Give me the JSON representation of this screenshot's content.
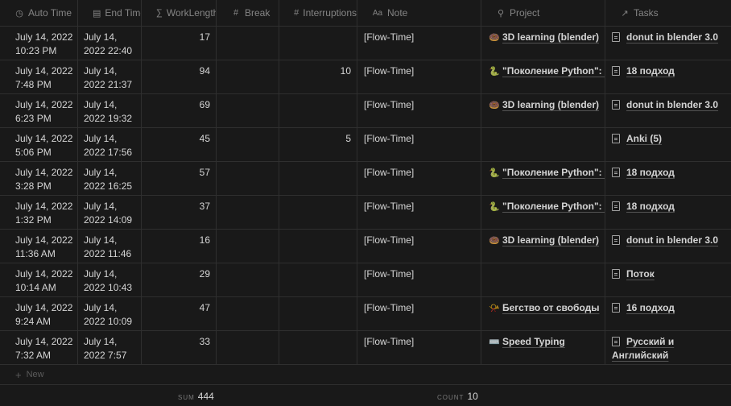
{
  "columns": [
    {
      "label": "Auto Time",
      "icon": "clock-icon",
      "glyph": "◷"
    },
    {
      "label": "End Time",
      "icon": "calendar-icon",
      "glyph": "▤"
    },
    {
      "label": "WorkLength",
      "icon": "sigma-icon",
      "glyph": "∑"
    },
    {
      "label": "Break",
      "icon": "hash-icon",
      "glyph": "#"
    },
    {
      "label": "Interruptions",
      "icon": "hash-icon",
      "glyph": "#"
    },
    {
      "label": "Note",
      "icon": "text-icon",
      "glyph": "Aa"
    },
    {
      "label": "Project",
      "icon": "search-icon",
      "glyph": "⚲"
    },
    {
      "label": "Tasks",
      "icon": "arrow-up-right-icon",
      "glyph": "↗"
    }
  ],
  "rows": [
    {
      "auto_date": "July 14, 2022",
      "auto_time": "10:23 PM",
      "end_date": "July 14,",
      "end_time": "2022 22:40",
      "work": "17",
      "break": "",
      "interruptions": "",
      "note": "[Flow-Time]",
      "project_emoji": "🍩",
      "project": "3D learning (blender)",
      "task": "donut in blender 3.0"
    },
    {
      "auto_date": "July 14, 2022",
      "auto_time": "7:48 PM",
      "end_date": "July 14,",
      "end_time": "2022 21:37",
      "work": "94",
      "break": "",
      "interruptions": "10",
      "note": "[Flow-Time]",
      "project_emoji": "🐍",
      "project": "\"Поколение Python\": курс",
      "task": "18 подход"
    },
    {
      "auto_date": "July 14, 2022",
      "auto_time": "6:23 PM",
      "end_date": "July 14,",
      "end_time": "2022 19:32",
      "work": "69",
      "break": "",
      "interruptions": "",
      "note": "[Flow-Time]",
      "project_emoji": "🍩",
      "project": "3D learning (blender)",
      "task": "donut in blender 3.0"
    },
    {
      "auto_date": "July 14, 2022",
      "auto_time": "5:06 PM",
      "end_date": "July 14,",
      "end_time": "2022 17:56",
      "work": "45",
      "break": "",
      "interruptions": "5",
      "note": "[Flow-Time]",
      "project_emoji": "",
      "project": "",
      "task": "Anki (5)"
    },
    {
      "auto_date": "July 14, 2022",
      "auto_time": "3:28 PM",
      "end_date": "July 14,",
      "end_time": "2022 16:25",
      "work": "57",
      "break": "",
      "interruptions": "",
      "note": "[Flow-Time]",
      "project_emoji": "🐍",
      "project": "\"Поколение Python\": курс",
      "task": "18 подход"
    },
    {
      "auto_date": "July 14, 2022",
      "auto_time": "1:32 PM",
      "end_date": "July 14,",
      "end_time": "2022 14:09",
      "work": "37",
      "break": "",
      "interruptions": "",
      "note": "[Flow-Time]",
      "project_emoji": "🐍",
      "project": "\"Поколение Python\": курс",
      "task": "18 подход"
    },
    {
      "auto_date": "July 14, 2022",
      "auto_time": "11:36 AM",
      "end_date": "July 14,",
      "end_time": "2022 11:46",
      "work": "16",
      "break": "",
      "interruptions": "",
      "note": "[Flow-Time]",
      "project_emoji": "🍩",
      "project": "3D learning (blender)",
      "task": "donut in blender 3.0"
    },
    {
      "auto_date": "July 14, 2022",
      "auto_time": "10:14 AM",
      "end_date": "July 14,",
      "end_time": "2022 10:43",
      "work": "29",
      "break": "",
      "interruptions": "",
      "note": "[Flow-Time]",
      "project_emoji": "",
      "project": "",
      "task": "Поток"
    },
    {
      "auto_date": "July 14, 2022",
      "auto_time": "9:24 AM",
      "end_date": "July 14,",
      "end_time": "2022 10:09",
      "work": "47",
      "break": "",
      "interruptions": "",
      "note": "[Flow-Time]",
      "project_emoji": "📯",
      "project": "Бегство от свободы",
      "task": "16 подход"
    },
    {
      "auto_date": "July 14, 2022",
      "auto_time": "7:32 AM",
      "end_date": "July 14,",
      "end_time": "2022 7:57",
      "work": "33",
      "break": "",
      "interruptions": "",
      "note": "[Flow-Time]",
      "project_emoji": "⌨️",
      "project": "Speed Typing",
      "task": "Русский и Английский"
    }
  ],
  "new_row": {
    "label": "New",
    "icon": "plus-icon"
  },
  "footer": {
    "sum_label": "SUM",
    "sum_value": "444",
    "count_label": "COUNT",
    "count_value": "10"
  }
}
